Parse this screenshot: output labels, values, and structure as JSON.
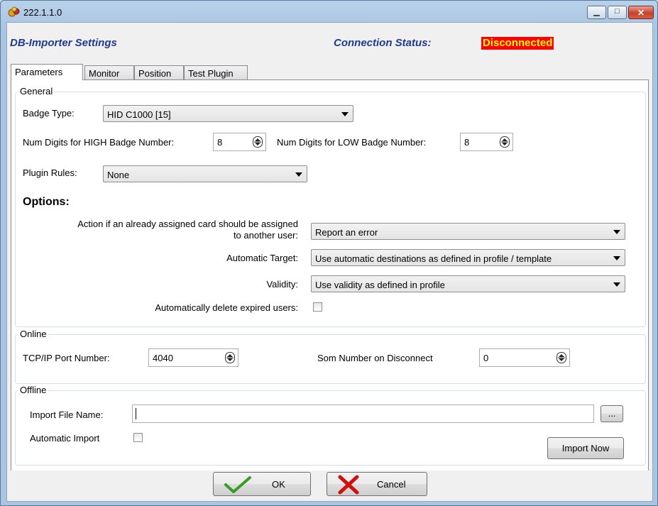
{
  "window": {
    "title": "222.1.1.0",
    "minimize_glyph": "▁",
    "maximize_glyph": "□",
    "close_glyph": "✕"
  },
  "header": {
    "app_title": "DB-Importer Settings",
    "connection_label": "Connection Status:",
    "connection_status": "Disconnected",
    "status_colors": {
      "background": "#ff0000",
      "text": "#ffff00"
    }
  },
  "tabs": [
    {
      "label": "Parameters",
      "active": true
    },
    {
      "label": "Monitor",
      "active": false
    },
    {
      "label": "Position",
      "active": false
    },
    {
      "label": "Test Plugin",
      "active": false
    }
  ],
  "general": {
    "title": "General",
    "badge_type_label": "Badge Type:",
    "badge_type_value": "HID C1000 [15]",
    "high_digits_label": "Num Digits for HIGH Badge Number:",
    "high_digits_value": "8",
    "low_digits_label": "Num Digits for LOW Badge Number:",
    "low_digits_value": "8",
    "plugin_rules_label": "Plugin Rules:",
    "plugin_rules_value": "None",
    "options_heading": "Options:",
    "action_label_line1": "Action if an already assigned card should be assigned",
    "action_label_line2": "to another user:",
    "action_value": "Report an error",
    "auto_target_label": "Automatic Target:",
    "auto_target_value": "Use automatic destinations as defined in profile / template",
    "validity_label": "Validity:",
    "validity_value": "Use validity as defined in profile",
    "auto_delete_label": "Automatically delete expired users:",
    "auto_delete_checked": false
  },
  "online": {
    "title": "Online",
    "port_label": "TCP/IP Port Number:",
    "port_value": "4040",
    "som_label": "Som Number on Disconnect",
    "som_value": "0"
  },
  "offline": {
    "title": "Offline",
    "import_file_label": "Import File Name:",
    "import_file_value": "",
    "browse_label": "...",
    "auto_import_label": "Automatic Import",
    "auto_import_checked": false,
    "import_now_label": "Import Now"
  },
  "footer": {
    "ok_label": "OK",
    "cancel_label": "Cancel"
  }
}
